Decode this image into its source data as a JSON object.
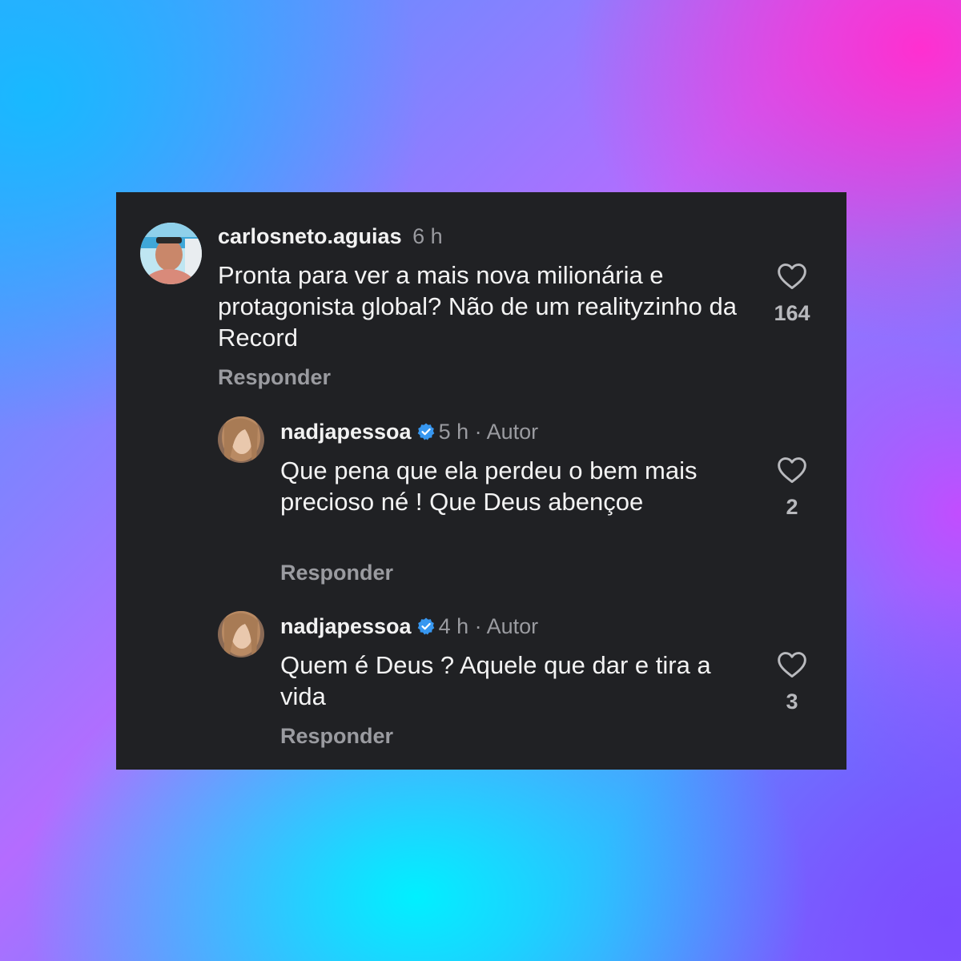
{
  "comments": [
    {
      "username": "carlosneto.aguias",
      "time": "6 h",
      "text": "Pronta para ver a mais nova milionária e protagonista global? Não de um realityzinho da Record",
      "reply_label": "Responder",
      "likes": "164",
      "icon": "heart-outline-icon"
    },
    {
      "username": "nadjapessoa",
      "verified": true,
      "time": "5 h",
      "author_label": "· Autor",
      "text": "Que pena que ela perdeu o bem mais precioso né ! Que Deus abençoe",
      "reply_label": "Responder",
      "likes": "2",
      "icon": "heart-outline-icon"
    },
    {
      "username": "nadjapessoa",
      "verified": true,
      "time": "4 h",
      "author_label": "· Autor",
      "text": "Quem é Deus ? Aquele que dar e tira a vida",
      "reply_label": "Responder",
      "likes": "3",
      "icon": "heart-outline-icon"
    }
  ],
  "colors": {
    "panel_bg": "#202124",
    "verified_badge": "#3797f0",
    "muted_text": "#9a9ba0"
  }
}
